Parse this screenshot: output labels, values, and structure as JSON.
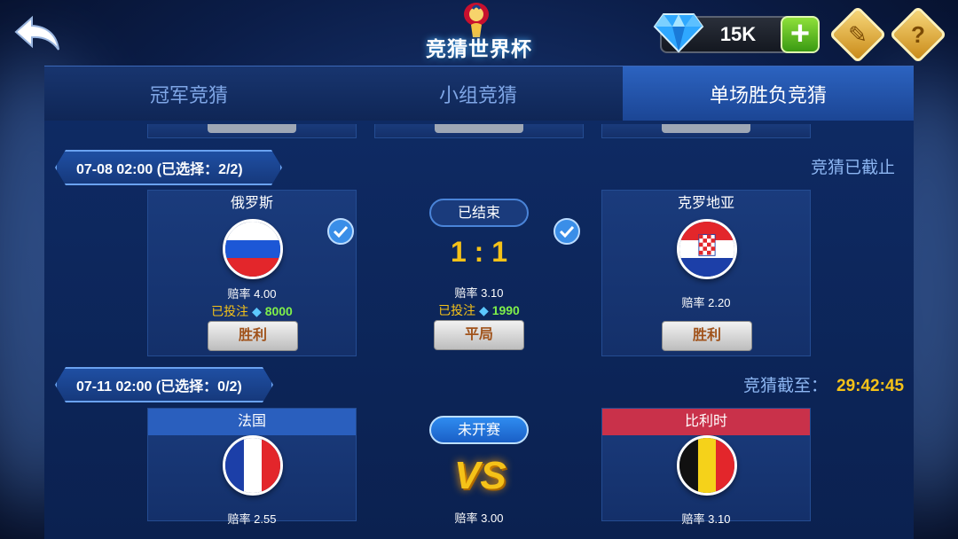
{
  "header": {
    "title": "竞猜世界杯",
    "gem_balance": "15K"
  },
  "tabs": [
    {
      "label": "冠军竞猜",
      "active": false
    },
    {
      "label": "小组竞猜",
      "active": false
    },
    {
      "label": "单场胜负竞猜",
      "active": true
    }
  ],
  "matches": [
    {
      "date_label": "07-08 02:00 (已选择：2/2)",
      "status_side": "竞猜已截止",
      "status_pill": "已结束",
      "score": "1 : 1",
      "home": {
        "name": "俄罗斯",
        "odds": "赔率 4.00",
        "bet_label": "已投注",
        "bet_amount": "8000",
        "button": "胜利",
        "checked": true
      },
      "draw": {
        "odds": "赔率 3.10",
        "bet_label": "已投注",
        "bet_amount": "1990",
        "button": "平局",
        "checked": true
      },
      "away": {
        "name": "克罗地亚",
        "odds": "赔率 2.20",
        "button": "胜利",
        "checked": false
      }
    },
    {
      "date_label": "07-11 02:00 (已选择：0/2)",
      "status_side": "竞猜截至：",
      "countdown": "29:42:45",
      "status_pill": "未开赛",
      "vs": "VS",
      "home": {
        "name": "法国",
        "odds": "赔率 2.55"
      },
      "draw": {
        "odds": "赔率 3.00"
      },
      "away": {
        "name": "比利时",
        "odds": "赔率 3.10"
      }
    }
  ],
  "colors": {
    "accent_gold": "#f5c218",
    "bet_green": "#7ff04a",
    "active_tab": "#2c63c0",
    "france_header": "#2a5fbe",
    "belgium_header": "#c9314a"
  },
  "icons": [
    "back-arrow-icon",
    "world-cup-logo-icon",
    "diamond-gem-icon",
    "plus-icon",
    "ticket-icon",
    "question-icon",
    "check-icon",
    "vs-icon"
  ]
}
